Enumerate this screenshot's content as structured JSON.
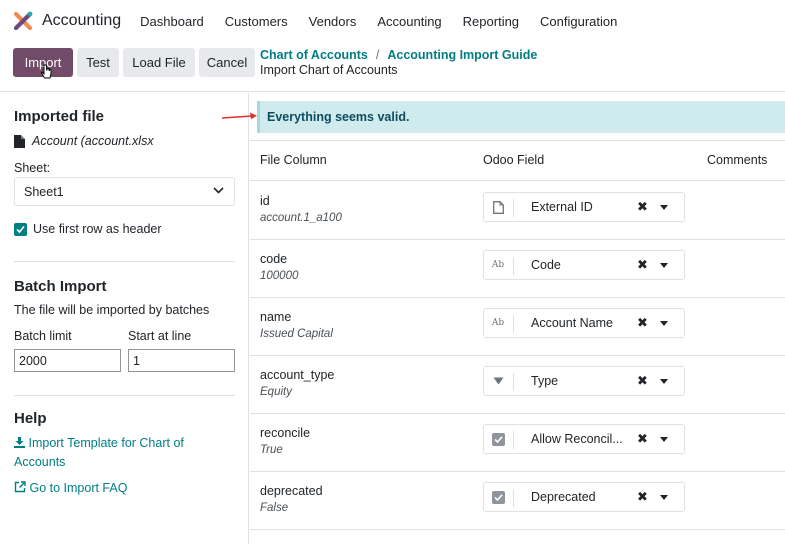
{
  "app": {
    "title": "Accounting"
  },
  "nav": [
    "Dashboard",
    "Customers",
    "Vendors",
    "Accounting",
    "Reporting",
    "Configuration"
  ],
  "toolbar": {
    "import": "Import",
    "test": "Test",
    "load_file": "Load File",
    "cancel": "Cancel"
  },
  "breadcrumb": {
    "link1": "Chart of Accounts",
    "sep": "/",
    "link2": "Accounting Import Guide",
    "current": "Import Chart of Accounts"
  },
  "sidebar": {
    "imported_file_heading": "Imported file",
    "file_name": "Account (account.xlsx",
    "sheet_label": "Sheet:",
    "sheet_value": "Sheet1",
    "header_checkbox_label": "Use first row as header",
    "batch_heading": "Batch Import",
    "batch_desc": "The file will be imported by batches",
    "batch_limit_label": "Batch limit",
    "start_line_label": "Start at line",
    "batch_limit_value": "2000",
    "start_line_value": "1",
    "help_heading": "Help",
    "help_template": "Import Template for Chart of Accounts",
    "help_faq": "Go to Import FAQ"
  },
  "alert": {
    "message": "Everything seems valid."
  },
  "table": {
    "headers": {
      "file_column": "File Column",
      "odoo_field": "Odoo Field",
      "comments": "Comments"
    },
    "rows": [
      {
        "name": "id",
        "sample": "account.1_a100",
        "field": "External ID",
        "icon": "file-icon"
      },
      {
        "name": "code",
        "sample": "100000",
        "field": "Code",
        "icon": "text-ab-icon"
      },
      {
        "name": "name",
        "sample": "Issued Capital",
        "field": "Account Name",
        "icon": "text-ab-icon"
      },
      {
        "name": "account_type",
        "sample": "Equity",
        "field": "Type",
        "icon": "caret-down-icon"
      },
      {
        "name": "reconcile",
        "sample": "True",
        "field": "Allow Reconcil...",
        "icon": "checkbox-icon"
      },
      {
        "name": "deprecated",
        "sample": "False",
        "field": "Deprecated",
        "icon": "checkbox-icon"
      }
    ]
  },
  "colors": {
    "primary": "#714B67",
    "link": "#017e84",
    "alert_bg": "#d0ebee"
  }
}
